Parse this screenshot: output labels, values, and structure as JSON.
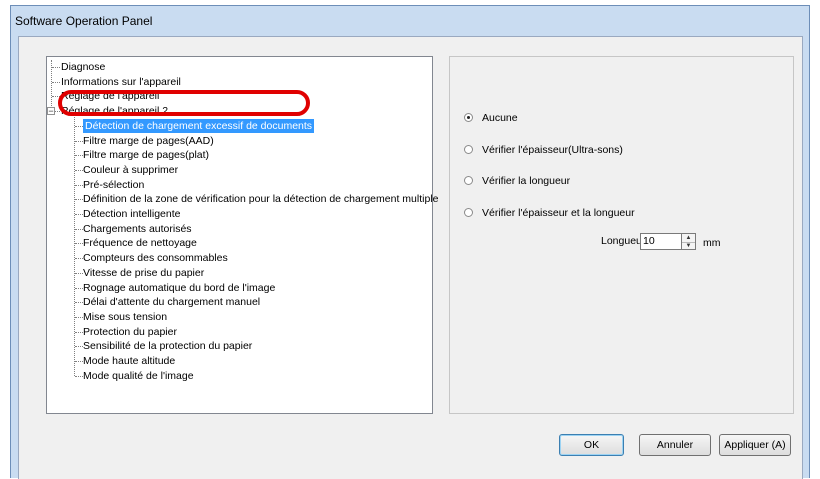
{
  "window": {
    "title": "Software Operation Panel"
  },
  "tree": {
    "items": [
      {
        "label": "Diagnose",
        "level": 0
      },
      {
        "label": "Informations sur l'appareil",
        "level": 0
      },
      {
        "label": "Réglage de l'appareil",
        "level": 0
      },
      {
        "label": "Réglage de l'appareil 2",
        "level": 0,
        "expanded": true
      },
      {
        "label": "Détection de chargement excessif de documents",
        "level": 1,
        "selected": true
      },
      {
        "label": "Filtre marge de pages(AAD)",
        "level": 1
      },
      {
        "label": "Filtre marge de pages(plat)",
        "level": 1
      },
      {
        "label": "Couleur à supprimer",
        "level": 1
      },
      {
        "label": "Pré-sélection",
        "level": 1
      },
      {
        "label": "Définition de la zone de vérification pour la détection de chargement multiple",
        "level": 1
      },
      {
        "label": "Détection intelligente",
        "level": 1
      },
      {
        "label": "Chargements autorisés",
        "level": 1
      },
      {
        "label": "Fréquence de nettoyage",
        "level": 1
      },
      {
        "label": "Compteurs des consommables",
        "level": 1
      },
      {
        "label": "Vitesse de prise du papier",
        "level": 1
      },
      {
        "label": "Rognage automatique du bord de l'image",
        "level": 1
      },
      {
        "label": "Délai d'attente du chargement manuel",
        "level": 1
      },
      {
        "label": "Mise sous tension",
        "level": 1
      },
      {
        "label": "Protection du papier",
        "level": 1
      },
      {
        "label": "Sensibilité de la protection du papier",
        "level": 1
      },
      {
        "label": "Mode haute altitude",
        "level": 1
      },
      {
        "label": "Mode qualité de l'image",
        "level": 1
      }
    ]
  },
  "options": {
    "radios": [
      {
        "label": "Aucune",
        "checked": true
      },
      {
        "label": "Vérifier l'épaisseur(Ultra-sons)",
        "checked": false
      },
      {
        "label": "Vérifier la longueur",
        "checked": false
      },
      {
        "label": "Vérifier l'épaisseur et la longueur",
        "checked": false
      }
    ],
    "length_label": "Longueur",
    "length_value": "10",
    "length_unit": "mm"
  },
  "buttons": {
    "ok": "OK",
    "cancel": "Annuler",
    "apply": "Appliquer (A)"
  },
  "colors": {
    "selection": "#3399ff",
    "highlight_ring": "#e00000",
    "window_frame": "#c9dcf1"
  }
}
